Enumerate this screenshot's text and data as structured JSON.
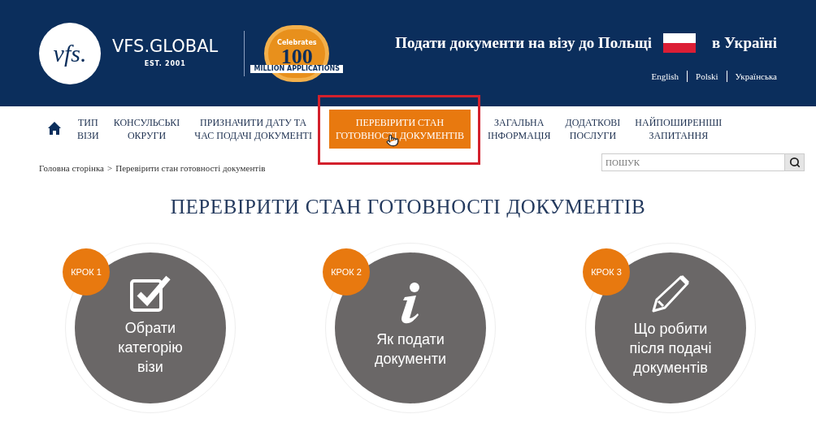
{
  "header": {
    "logo_text": "vfs.",
    "brand": "VFS.GLOBAL",
    "established": "EST. 2001",
    "badge": {
      "top": "Celebrates",
      "number": "100",
      "ribbon": "MILLION APPLICATIONS"
    },
    "tagline_before": "Подати документи на візу до Польщі",
    "tagline_after": "в Україні",
    "languages": [
      {
        "label": "English"
      },
      {
        "label": "Polski"
      },
      {
        "label": "Українська"
      }
    ]
  },
  "nav": {
    "items": [
      {
        "lines": [
          "ТИП",
          "ВІЗИ"
        ],
        "selected": false,
        "annotated": false
      },
      {
        "lines": [
          "КОНСУЛЬСЬКІ",
          "ОКРУГИ"
        ],
        "selected": false,
        "annotated": false
      },
      {
        "lines": [
          "ПРИЗНАЧИТИ ДАТУ ТА",
          "ЧАС ПОДАЧІ ДОКУМЕНТІ"
        ],
        "selected": false,
        "annotated": false
      },
      {
        "lines": [
          "ПЕРЕВІРИТИ СТАН",
          "ГОТОВНОСТІ ДОКУМЕНТІВ"
        ],
        "selected": true,
        "annotated": true
      },
      {
        "lines": [
          "ЗАГАЛЬНА",
          "ІНФОРМАЦІЯ"
        ],
        "selected": false,
        "annotated": false
      },
      {
        "lines": [
          "ДОДАТКОВІ",
          "ПОСЛУГИ"
        ],
        "selected": false,
        "annotated": false
      },
      {
        "lines": [
          "НАЙПОШИРЕНІШІ",
          "ЗАПИТАННЯ"
        ],
        "selected": false,
        "annotated": false
      }
    ],
    "search_placeholder": "ПОШУК"
  },
  "breadcrumb": [
    {
      "label": "Головна сторінка"
    },
    {
      "label": ">"
    },
    {
      "label": "Перевірити стан готовності документів"
    }
  ],
  "title": "ПЕРЕВІРИТИ СТАН ГОТОВНОСТІ ДОКУМЕНТІВ",
  "steps": [
    {
      "badge": "КРОК 1",
      "kind": "checkbox",
      "lines": [
        "Обрати",
        "категорію",
        "візи"
      ]
    },
    {
      "badge": "КРОК 2",
      "kind": "info",
      "lines": [
        "Як подати",
        "документи"
      ]
    },
    {
      "badge": "КРОК 3",
      "kind": "pencil",
      "lines": [
        "Що робити",
        "після подачі",
        "документів"
      ]
    }
  ]
}
